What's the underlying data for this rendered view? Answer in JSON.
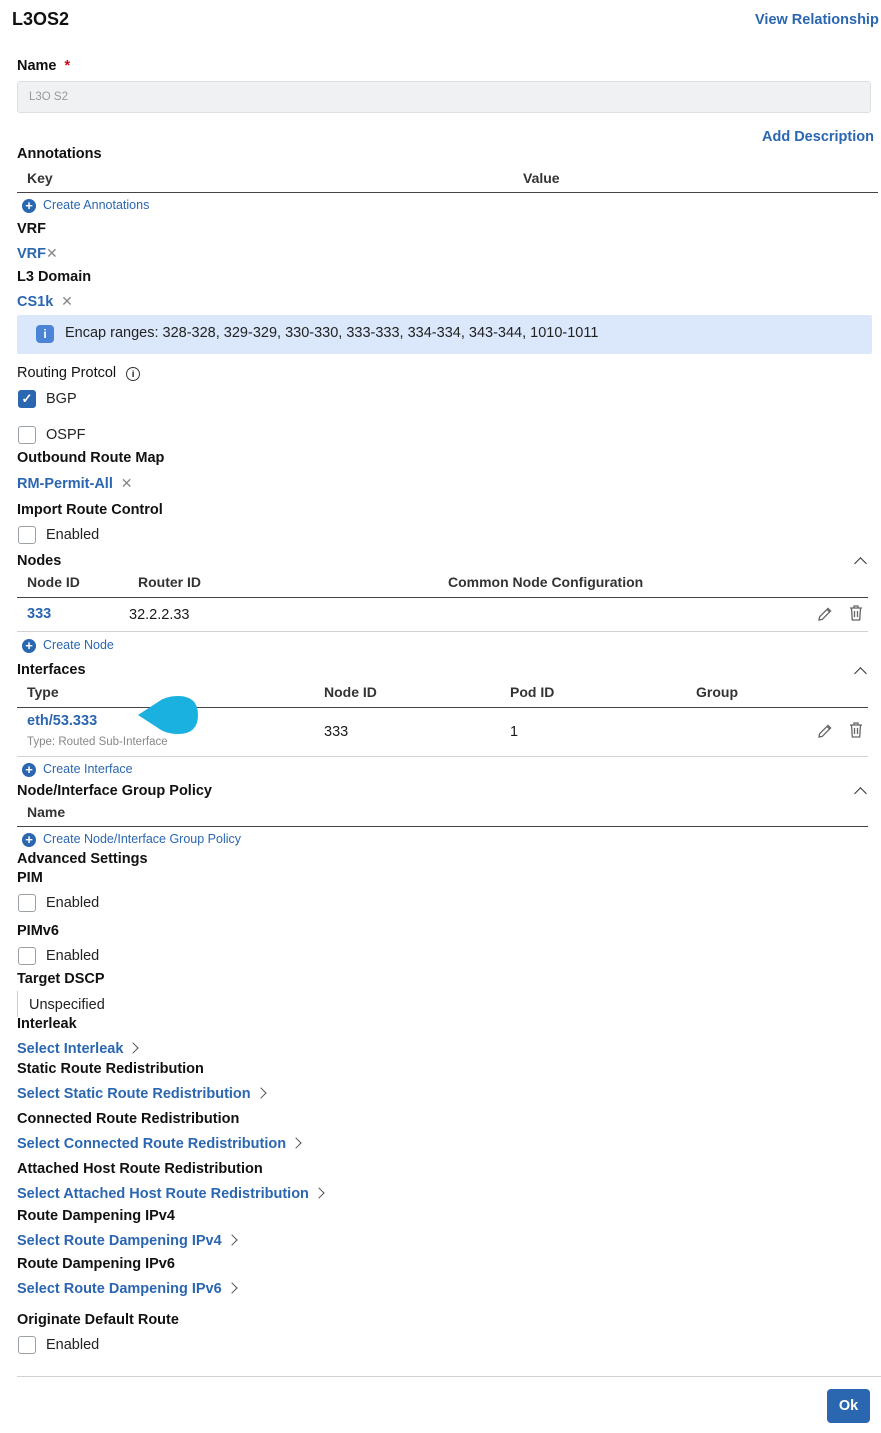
{
  "header": {
    "title": "L3OS2",
    "view_relationship": "View Relationship"
  },
  "name_field": {
    "label": "Name",
    "required_mark": "*",
    "value": "L3O S2"
  },
  "add_description": "Add Description",
  "annotations": {
    "label": "Annotations",
    "columns": [
      "Key",
      "Value"
    ],
    "create": "Create Annotations"
  },
  "vrf": {
    "label": "VRF",
    "value": "VRF"
  },
  "l3_domain": {
    "label": "L3 Domain",
    "value": "CS1k"
  },
  "encap_info": "Encap ranges: 328-328, 329-329, 330-330, 333-333, 334-334, 343-344, 1010-1011",
  "routing_protocol": {
    "label": "Routing Protcol",
    "options": [
      {
        "label": "BGP",
        "checked": true
      },
      {
        "label": "OSPF",
        "checked": false
      }
    ]
  },
  "outbound_route_map": {
    "label": "Outbound Route Map",
    "value": "RM-Permit-All"
  },
  "import_route_control": {
    "label": "Import Route Control",
    "checkbox": "Enabled",
    "checked": false
  },
  "nodes": {
    "label": "Nodes",
    "columns": [
      "Node ID",
      "Router ID",
      "Common Node Configuration"
    ],
    "rows": [
      {
        "node_id": "333",
        "router_id": "32.2.2.33"
      }
    ],
    "create": "Create Node"
  },
  "interfaces": {
    "label": "Interfaces",
    "columns": [
      "Type",
      "Node ID",
      "Pod ID",
      "Group"
    ],
    "rows": [
      {
        "type": "eth/53.333",
        "subtype": "Type: Routed Sub-Interface",
        "node_id": "333",
        "pod_id": "1"
      }
    ],
    "create": "Create Interface"
  },
  "group_policy": {
    "label": "Node/Interface Group Policy",
    "columns": [
      "Name"
    ],
    "create": "Create Node/Interface Group Policy"
  },
  "advanced": {
    "label": "Advanced Settings",
    "pim": {
      "label": "PIM",
      "checkbox": "Enabled"
    },
    "pimv6": {
      "label": "PIMv6",
      "checkbox": "Enabled"
    },
    "target_dscp": {
      "label": "Target DSCP",
      "value": "Unspecified"
    },
    "interleak": {
      "label": "Interleak",
      "link": "Select Interleak"
    },
    "static_redist": {
      "label": "Static Route Redistribution",
      "link": "Select Static Route Redistribution"
    },
    "connected_redist": {
      "label": "Connected Route Redistribution",
      "link": "Select Connected Route Redistribution"
    },
    "attached_redist": {
      "label": "Attached Host Route Redistribution",
      "link": "Select Attached Host Route Redistribution"
    },
    "damp_ipv4": {
      "label": "Route Dampening IPv4",
      "link": "Select Route Dampening IPv4"
    },
    "damp_ipv6": {
      "label": "Route Dampening IPv6",
      "link": "Select Route Dampening IPv6"
    },
    "originate_default": {
      "label": "Originate Default Route",
      "checkbox": "Enabled"
    }
  },
  "footer": {
    "ok": "Ok"
  },
  "colors": {
    "accent": "#2b66b1",
    "info_bg": "#dbe8fb",
    "callout": "#1ab0e0"
  }
}
